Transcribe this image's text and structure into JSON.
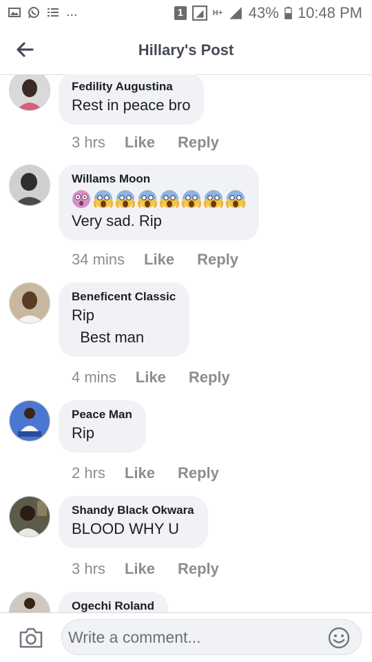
{
  "status_bar": {
    "left_icons": [
      "image-icon",
      "whatsapp-icon",
      "list-icon",
      "more-icon"
    ],
    "more": "...",
    "right_icons": [
      "notification-badge-icon",
      "signal-icon",
      "h-plus-icon",
      "signal-icon",
      "battery-icon"
    ],
    "badge": "1",
    "network": "H+",
    "battery": "43%",
    "time": "10:48 PM"
  },
  "header": {
    "title": "Hillary's Post",
    "back_icon": "arrow-left-icon"
  },
  "comments": [
    {
      "name": "Fedility Augustina",
      "lines": [
        "Rest in peace bro"
      ],
      "time": "3 hrs",
      "like": "Like",
      "reply": "Reply",
      "avatar_color": "#c85a6c"
    },
    {
      "name": "Willams Moon",
      "emojis": [
        "astonished-face-icon",
        "screaming-face-icon",
        "screaming-face-icon",
        "screaming-face-icon",
        "screaming-face-icon",
        "screaming-face-icon",
        "screaming-face-icon",
        "screaming-face-icon"
      ],
      "lines": [
        "Very sad. Rip"
      ],
      "time": "34 mins",
      "like": "Like",
      "reply": "Reply",
      "avatar_color": "#5a5a5a"
    },
    {
      "name": "Beneficent Classic",
      "lines": [
        "Rip",
        "  Best man"
      ],
      "time": "4 mins",
      "like": "Like",
      "reply": "Reply",
      "avatar_color": "#9a7d5e"
    },
    {
      "name": "Peace Man",
      "lines": [
        "Rip"
      ],
      "time": "2 hrs",
      "like": "Like",
      "reply": "Reply",
      "avatar_color": "#3b5bb5"
    },
    {
      "name": "Shandy Black Okwara",
      "lines": [
        "BLOOD WHY U"
      ],
      "time": "3 hrs",
      "like": "Like",
      "reply": "Reply",
      "avatar_color": "#4c4638"
    },
    {
      "name": "Ogechi Roland",
      "lines": [],
      "time": "",
      "like": "",
      "reply": "",
      "avatar_color": "#6a4a3a"
    }
  ],
  "composer": {
    "placeholder": "Write a comment...",
    "camera_icon": "camera-icon",
    "emoji_icon": "smiley-icon"
  }
}
